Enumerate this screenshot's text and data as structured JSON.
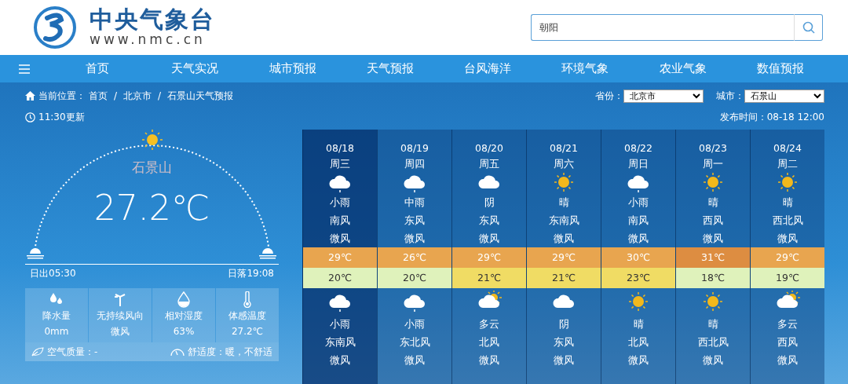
{
  "header": {
    "logo_title": "中央气象台",
    "logo_url": "www.nmc.cn",
    "search": {
      "value": "朝阳"
    }
  },
  "nav": {
    "items": [
      "首页",
      "天气实况",
      "城市预报",
      "天气预报",
      "台风海洋",
      "环境气象",
      "农业气象",
      "数值预报"
    ]
  },
  "breadcrumb": {
    "prefix": "当前位置：",
    "separator": "/",
    "items": [
      "首页",
      "北京市",
      "石景山天气预报"
    ]
  },
  "update_time": "11:30更新",
  "selectors": [
    {
      "label": "省份：",
      "value": "北京市"
    },
    {
      "label": "城市：",
      "value": "石景山"
    }
  ],
  "publish_time": "发布时间：08-18 12:00",
  "current": {
    "city": "石景山",
    "temperature": "27.2℃",
    "sunrise": "日出05:30",
    "sunset": "日落19:08",
    "stats": [
      {
        "kind": "rain",
        "label": "降水量",
        "value": "0mm"
      },
      {
        "kind": "wind",
        "label": "无持续风向",
        "value": "微风"
      },
      {
        "kind": "humidity",
        "label": "相对湿度",
        "value": "63%"
      },
      {
        "kind": "feels",
        "label": "体感温度",
        "value": "27.2℃"
      }
    ],
    "air_quality": "空气质量：-",
    "comfort": "舒适度：暖，不舒适"
  },
  "forecast": [
    {
      "date": "08/18",
      "weekday": "周三",
      "selected": true,
      "day": {
        "kind": "rain",
        "weather": "小雨",
        "wind_dir": "南风",
        "wind_level": "微风"
      },
      "high": {
        "temp": "29℃",
        "color": "#e8a54f"
      },
      "low": {
        "temp": "20℃",
        "color": "#dff2bb"
      },
      "night": {
        "kind": "rain",
        "weather": "小雨",
        "wind_dir": "东南风",
        "wind_level": "微风"
      }
    },
    {
      "date": "08/19",
      "weekday": "周四",
      "selected": false,
      "day": {
        "kind": "rain",
        "weather": "中雨",
        "wind_dir": "东风",
        "wind_level": "微风"
      },
      "high": {
        "temp": "26℃",
        "color": "#e8a54f"
      },
      "low": {
        "temp": "20℃",
        "color": "#dff2bb"
      },
      "night": {
        "kind": "rain",
        "weather": "小雨",
        "wind_dir": "东北风",
        "wind_level": "微风"
      }
    },
    {
      "date": "08/20",
      "weekday": "周五",
      "selected": false,
      "day": {
        "kind": "overcast",
        "weather": "阴",
        "wind_dir": "东风",
        "wind_level": "微风"
      },
      "high": {
        "temp": "29℃",
        "color": "#e8a54f"
      },
      "low": {
        "temp": "21℃",
        "color": "#f0dc64"
      },
      "night": {
        "kind": "cloudy",
        "weather": "多云",
        "wind_dir": "北风",
        "wind_level": "微风"
      }
    },
    {
      "date": "08/21",
      "weekday": "周六",
      "selected": false,
      "day": {
        "kind": "sunny",
        "weather": "晴",
        "wind_dir": "东南风",
        "wind_level": "微风"
      },
      "high": {
        "temp": "29℃",
        "color": "#e8a54f"
      },
      "low": {
        "temp": "21℃",
        "color": "#f0dc64"
      },
      "night": {
        "kind": "overcast",
        "weather": "阴",
        "wind_dir": "东风",
        "wind_level": "微风"
      }
    },
    {
      "date": "08/22",
      "weekday": "周日",
      "selected": false,
      "day": {
        "kind": "rain",
        "weather": "小雨",
        "wind_dir": "南风",
        "wind_level": "微风"
      },
      "high": {
        "temp": "30℃",
        "color": "#e8a54f"
      },
      "low": {
        "temp": "23℃",
        "color": "#f0dc64"
      },
      "night": {
        "kind": "sunny",
        "weather": "晴",
        "wind_dir": "北风",
        "wind_level": "微风"
      }
    },
    {
      "date": "08/23",
      "weekday": "周一",
      "selected": false,
      "day": {
        "kind": "sunny",
        "weather": "晴",
        "wind_dir": "西风",
        "wind_level": "微风"
      },
      "high": {
        "temp": "31℃",
        "color": "#dd8d41"
      },
      "low": {
        "temp": "18℃",
        "color": "#dff2bb"
      },
      "night": {
        "kind": "sunny",
        "weather": "晴",
        "wind_dir": "西北风",
        "wind_level": "微风"
      }
    },
    {
      "date": "08/24",
      "weekday": "周二",
      "selected": false,
      "day": {
        "kind": "sunny",
        "weather": "晴",
        "wind_dir": "西北风",
        "wind_level": "微风"
      },
      "high": {
        "temp": "29℃",
        "color": "#e8a54f"
      },
      "low": {
        "temp": "19℃",
        "color": "#dff2bb"
      },
      "night": {
        "kind": "cloudy",
        "weather": "多云",
        "wind_dir": "西风",
        "wind_level": "微风"
      }
    }
  ]
}
